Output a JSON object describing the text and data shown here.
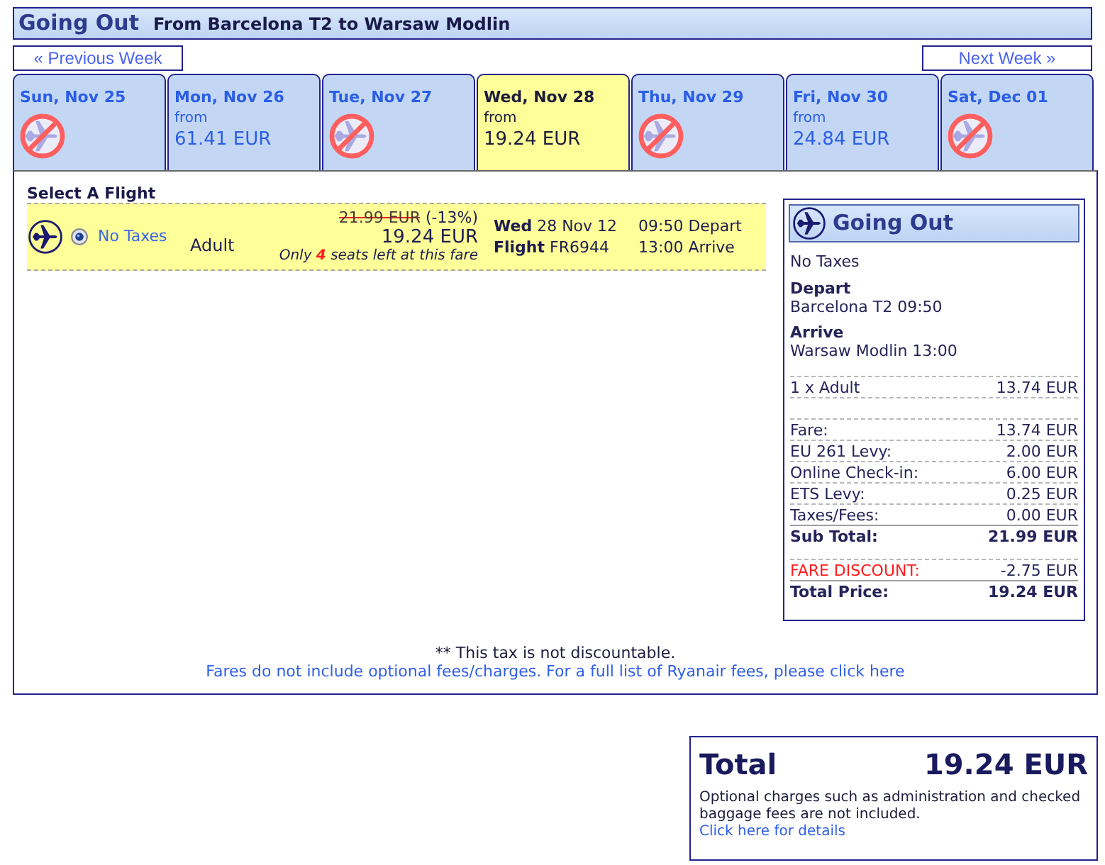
{
  "header": {
    "title": "Going Out",
    "route": "From Barcelona T2 to Warsaw Modlin"
  },
  "week_nav": {
    "previous": "« Previous Week",
    "next": "Next Week »"
  },
  "date_tabs": [
    {
      "date": "Sun, Nov 25",
      "kind": "unavailable",
      "selected": false
    },
    {
      "date": "Mon, Nov 26",
      "kind": "fare",
      "from_label": "from",
      "price": "61.41 EUR",
      "selected": false
    },
    {
      "date": "Tue, Nov 27",
      "kind": "unavailable",
      "selected": false
    },
    {
      "date": "Wed, Nov 28",
      "kind": "fare",
      "from_label": "from",
      "price": "19.24 EUR",
      "selected": true
    },
    {
      "date": "Thu, Nov 29",
      "kind": "unavailable",
      "selected": false
    },
    {
      "date": "Fri, Nov 30",
      "kind": "fare",
      "from_label": "from",
      "price": "24.84 EUR",
      "selected": false
    },
    {
      "date": "Sat, Dec 01",
      "kind": "unavailable",
      "selected": false
    }
  ],
  "flight_list": {
    "title": "Select A Flight",
    "flights": [
      {
        "selected": true,
        "fare_type": "No Taxes",
        "passenger": "Adult",
        "old_price": "21.99 EUR",
        "discount": "(-13%)",
        "price": "19.24 EUR",
        "seats_note": "Only **4** seats left at this fare",
        "date": "**Wed** 28 Nov 12",
        "flight": "**Flight** FR6944",
        "depart": "09:50 Depart",
        "arrive": "13:00 Arrive"
      }
    ]
  },
  "summary": {
    "title": "Going Out",
    "fare_type": "No Taxes",
    "depart_label": "Depart",
    "depart_value": "Barcelona T2 09:50",
    "arrive_label": "Arrive",
    "arrive_value": "Warsaw Modlin 13:00",
    "passengers": [
      {
        "label": "1 x Adult",
        "amount": "13.74 EUR"
      }
    ],
    "charges": [
      {
        "kind": "fee",
        "label": "Fare:",
        "amount": "13.74 EUR"
      },
      {
        "kind": "fee",
        "label": "EU 261 Levy:",
        "amount": "2.00 EUR"
      },
      {
        "kind": "fee",
        "label": "Online Check-in:",
        "amount": "6.00 EUR"
      },
      {
        "kind": "fee",
        "label": "ETS Levy:",
        "amount": "0.25 EUR"
      },
      {
        "kind": "fee",
        "label": "Taxes/Fees:",
        "amount": "0.00 EUR"
      },
      {
        "kind": "subtotal",
        "label": "Sub Total:",
        "amount": "21.99 EUR"
      },
      {
        "kind": "discount",
        "label": "FARE DISCOUNT:",
        "amount": "-2.75 EUR"
      },
      {
        "kind": "total",
        "label": "Total Price:",
        "amount": "19.24 EUR"
      }
    ]
  },
  "footer": {
    "note": "** This tax is not discountable.",
    "fees_link": "Fares do not include optional fees/charges. For a full list of Ryanair fees, please click here"
  },
  "total_box": {
    "label": "Total",
    "amount": "19.24 EUR",
    "note": "Optional charges such as administration and checked baggage fees are not included.",
    "details_link": "Click here for details"
  }
}
